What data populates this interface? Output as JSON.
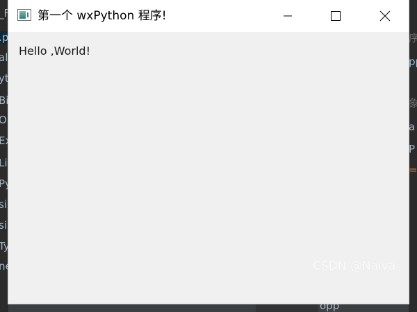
{
  "window": {
    "title": "第一个 wxPython 程序!",
    "content_text": "Hello ,World!",
    "controls": {
      "minimize_icon": "minimize-icon",
      "maximize_icon": "maximize-icon",
      "close_icon": "close-icon"
    }
  },
  "background_editor": {
    "left_fragments": [
      "_F",
      ".p",
      "al",
      "yt",
      "Bi",
      "O",
      "Ex",
      "Li",
      "Py",
      "si",
      "si",
      "Ty",
      "ne"
    ],
    "right_fragments": [
      "序",
      "pp",
      "象",
      "a",
      "P",
      "="
    ],
    "bottom_fragment": "opp"
  },
  "watermark": "CSDN @Naiva",
  "colors": {
    "window_bg": "#f0f0f0",
    "titlebar_bg": "#ffffff",
    "editor_bg": "#2b2b2b"
  }
}
